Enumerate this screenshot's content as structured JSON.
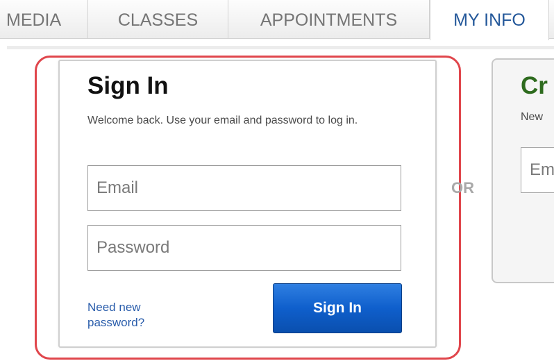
{
  "nav": {
    "tabs": [
      {
        "label": "MEDIA"
      },
      {
        "label": "CLASSES"
      },
      {
        "label": "APPOINTMENTS"
      },
      {
        "label": "MY INFO",
        "active": true
      }
    ]
  },
  "signin": {
    "title": "Sign In",
    "description": "Welcome back. Use your email and password to log in.",
    "email_placeholder": "Email",
    "password_placeholder": "Password",
    "forgot_link": "Need new password?",
    "button_label": "Sign In"
  },
  "separator": {
    "label": "OR"
  },
  "create_account": {
    "title_visible": "Cr",
    "description_visible": "New",
    "email_placeholder": "Em"
  },
  "colors": {
    "active_tab_text": "#24589a",
    "inactive_tab_text": "#757575",
    "primary_button": "#0f5fcc",
    "link": "#2a5dab",
    "create_title": "#2e6b1e",
    "highlight_ring": "#e0464c"
  }
}
